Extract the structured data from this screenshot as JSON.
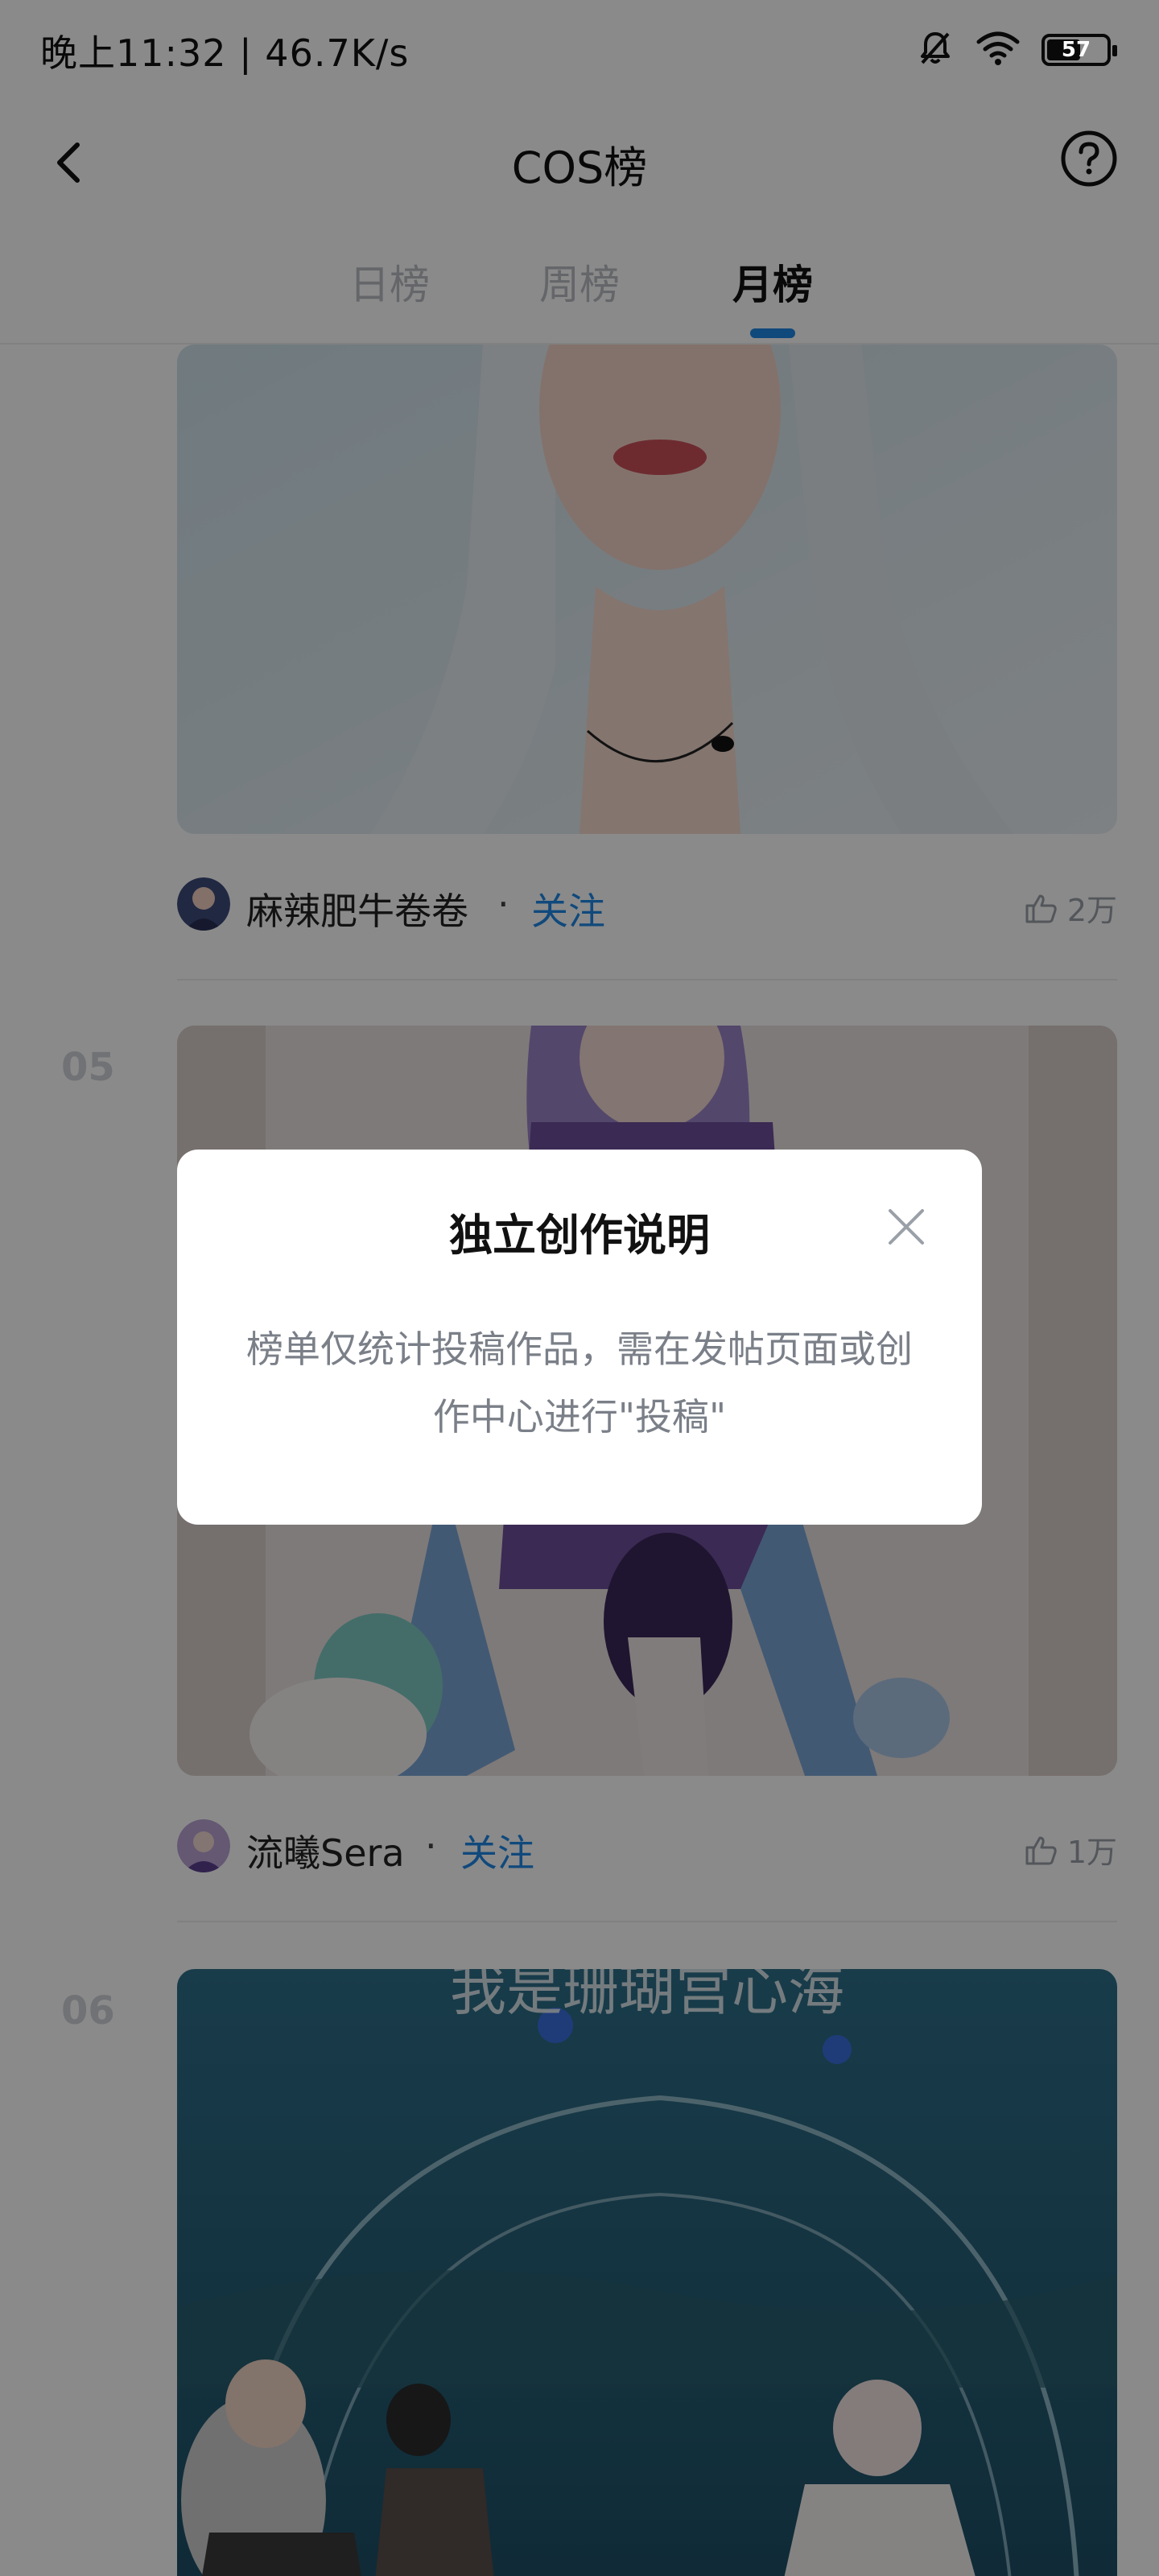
{
  "status_bar": {
    "time_speed": "晚上11:32 | 46.7K/s",
    "battery": "57"
  },
  "header": {
    "title": "COS榜"
  },
  "tabs": [
    {
      "label": "日榜",
      "active": false
    },
    {
      "label": "周榜",
      "active": false
    },
    {
      "label": "月榜",
      "active": true
    }
  ],
  "posts": [
    {
      "rank": "",
      "author": "麻辣肥牛卷卷",
      "follow_label": "关注",
      "likes": "2万"
    },
    {
      "rank": "05",
      "author": "流曦Sera",
      "follow_label": "关注",
      "likes": "1万"
    },
    {
      "rank": "06",
      "image_caption": "我是珊瑚宫心海"
    }
  ],
  "dialog": {
    "title": "独立创作说明",
    "body": "榜单仅统计投稿作品，需在发帖页面或创作中心进行\"投稿\""
  },
  "colors": {
    "accent": "#1e88e5",
    "overlay": "rgba(0,0,0,0.46)"
  },
  "icons": {
    "back": "chevron-left-icon",
    "help": "question-circle-icon",
    "close": "close-icon",
    "like": "thumbs-up-icon",
    "mute": "bell-off-icon",
    "wifi": "wifi-icon",
    "battery": "battery-icon"
  }
}
